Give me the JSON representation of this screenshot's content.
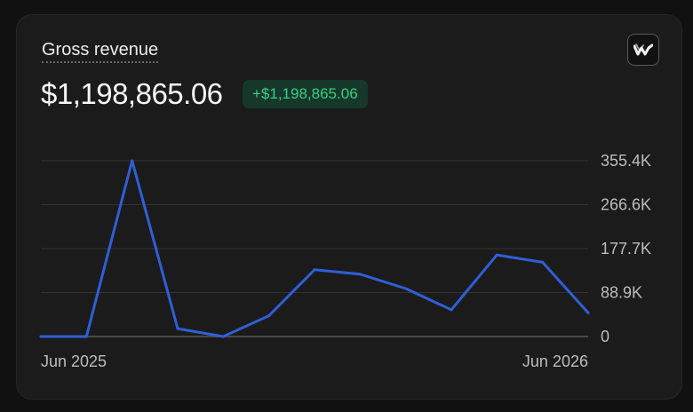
{
  "card": {
    "title": "Gross revenue",
    "total": "$1,198,865.06",
    "change": "+$1,198,865.06",
    "icon": "chart-style-icon"
  },
  "colors": {
    "line": "#2f5fd6",
    "badge_bg": "#15382a",
    "badge_text": "#3ccf7e",
    "grid": "#333333",
    "baseline": "#4a4a4a"
  },
  "chart_data": {
    "type": "line",
    "ylim": [
      0,
      355400
    ],
    "yticks": [
      0,
      88900,
      177700,
      266600,
      355400
    ],
    "ytick_labels": [
      "0",
      "88.9K",
      "177.7K",
      "266.6K",
      "355.4K"
    ],
    "x_start_label": "Jun 2025",
    "x_end_label": "Jun 2026",
    "grid": true,
    "series": [
      {
        "values": [
          0,
          0,
          355400,
          16000,
          0,
          42000,
          135000,
          126000,
          97000,
          54000,
          165000,
          150000,
          48000
        ]
      }
    ]
  }
}
